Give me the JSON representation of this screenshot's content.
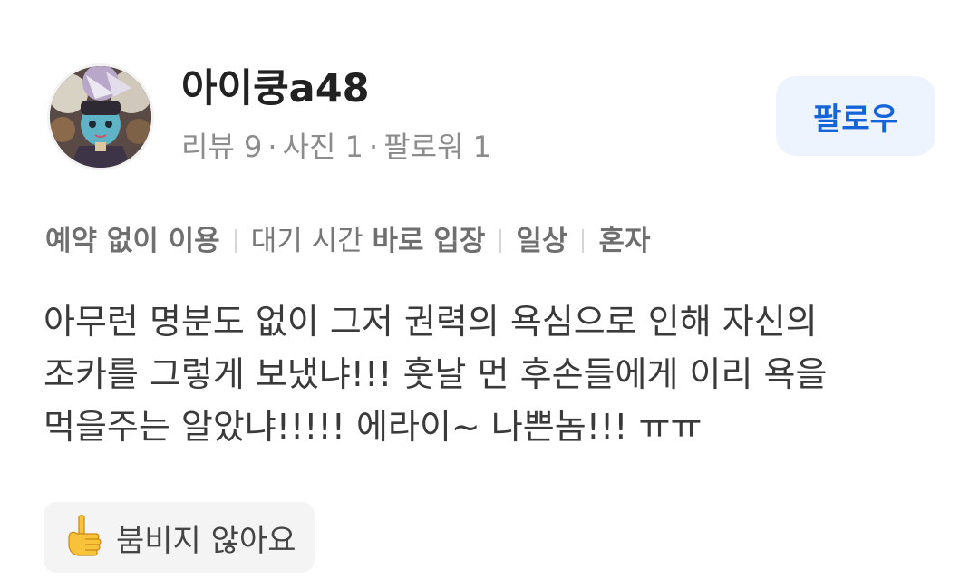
{
  "profile": {
    "username": "아이쿵a48",
    "stats": {
      "reviews": "리뷰 9",
      "photos": "사진 1",
      "followers": "팔로워 1",
      "separator": "·"
    },
    "follow_label": "팔로우"
  },
  "tags": {
    "visit_type": "예약 없이 이용",
    "wait_prefix": "대기 시간",
    "wait_value": "바로 입장",
    "purpose": "일상",
    "companion": "혼자"
  },
  "review": {
    "lines": [
      "아무런 명분도 없이 그저 권력의 욕심으로 인해 자신의",
      "조카를 그렇게 보냈냐!!! 훗날 먼 후손들에게 이리 욕을",
      "먹을주는 알았냐!!!!! 에라이~ 나쁜놈!!! ㅠㅠ"
    ]
  },
  "reaction": {
    "icon": "pointing-up-hand-icon",
    "label": "붐비지 않아요"
  },
  "colors": {
    "accent": "#1565d8",
    "follow_bg": "#eef4fd",
    "muted_text": "#8c8c8c",
    "badge_bg": "#f4f4f4"
  }
}
